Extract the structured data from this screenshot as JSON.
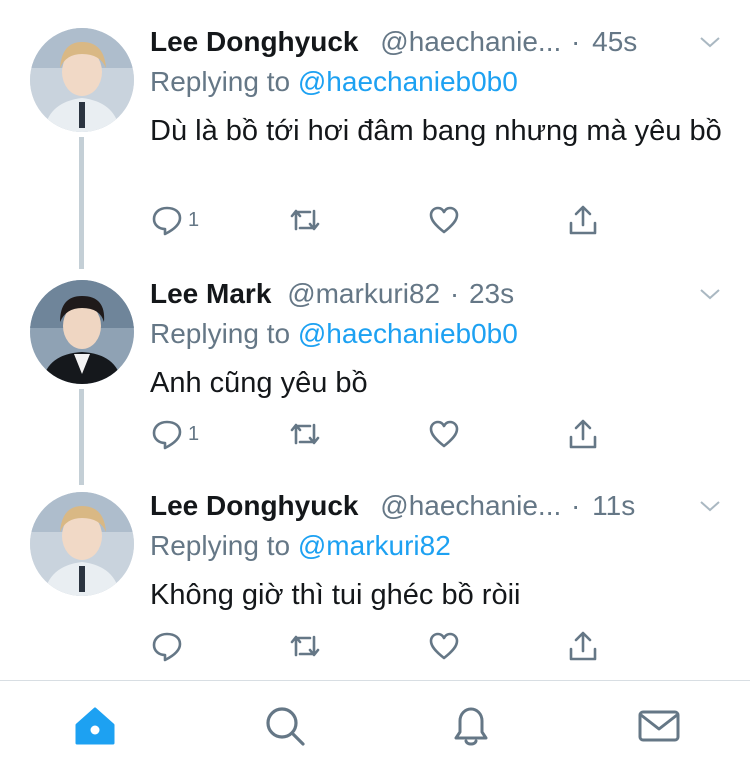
{
  "tweets": [
    {
      "display_name": "Lee Donghyuck",
      "handle": "@haechanie...",
      "separator": "·",
      "time": "45s",
      "replying_prefix": "Replying to",
      "replying_handle": "@haechanieb0b0",
      "text": "Dù là bồ tới hơi đâm bang nhưng mà yêu bồ",
      "reply_count": "1"
    },
    {
      "display_name": "Lee Mark",
      "handle": "@markuri82",
      "separator": "·",
      "time": "23s",
      "replying_prefix": "Replying to",
      "replying_handle": "@haechanieb0b0",
      "text": "Anh cũng yêu bồ",
      "reply_count": "1"
    },
    {
      "display_name": "Lee Donghyuck",
      "handle": "@haechanie...",
      "separator": "·",
      "time": "11s",
      "replying_prefix": "Replying to",
      "replying_handle": "@markuri82",
      "text": "Không giờ thì tui ghéc bồ ròii",
      "reply_count": ""
    }
  ],
  "colors": {
    "accent": "#1da1f2",
    "icon": "#657786",
    "text": "#14171a"
  },
  "tabs": [
    "home-icon",
    "search-icon",
    "notifications-icon",
    "messages-icon"
  ]
}
